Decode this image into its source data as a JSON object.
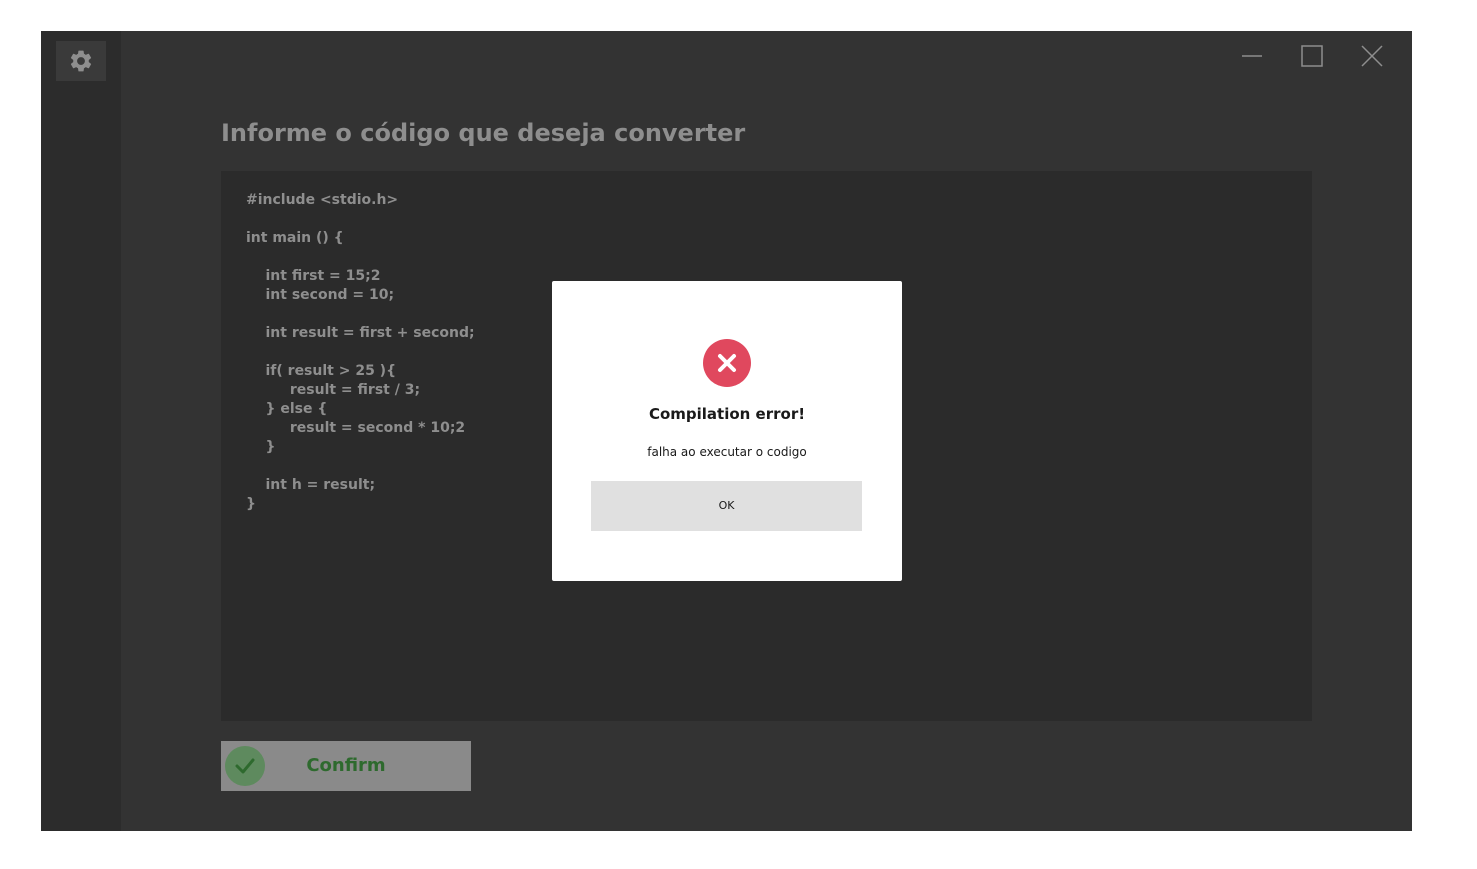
{
  "window": {
    "controls": {
      "minimize_icon": "minimize-icon",
      "maximize_icon": "maximize-icon",
      "close_icon": "close-icon"
    }
  },
  "sidebar": {
    "settings_icon": "gear-icon"
  },
  "main": {
    "heading": "Informe o código que deseja converter",
    "code": "#include <stdio.h>\n\nint main () {\n\n    int first = 15;2\n    int second = 10;\n\n    int result = first + second;\n\n    if( result > 25 ){\n         result = first / 3;\n    } else {\n         result = second * 10;2\n    }\n\n    int h = result;\n}",
    "confirm_button": {
      "label": "Confirm",
      "icon": "check-icon",
      "text_color": "#2e6a2e"
    }
  },
  "dialog": {
    "icon": "error-x-icon",
    "icon_color": "#e0485e",
    "title": "Compilation error!",
    "message": "falha ao executar o codigo",
    "ok_label": "OK"
  },
  "colors": {
    "window_bg": "#333333",
    "sidebar_bg": "#2c2c2c",
    "code_bg": "#2b2b2b",
    "text_muted": "#8e8e8e"
  }
}
